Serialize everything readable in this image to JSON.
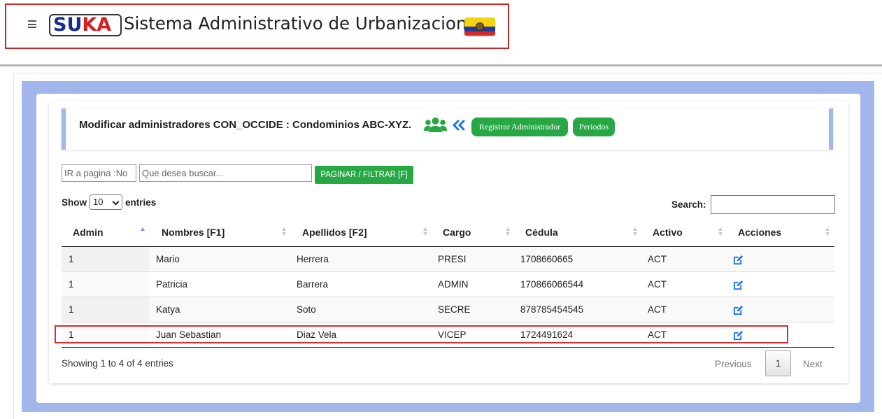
{
  "header": {
    "logo_part1": "SU",
    "logo_part2": "KA",
    "app_title": "Sistema Administrativo de Urbanizaciones"
  },
  "form": {
    "title": "Modificar administradores CON_OCCIDE : Condominios ABC-XYZ.",
    "register_button": "Registrar Administrador",
    "periods_button": "Períodos"
  },
  "filters": {
    "page_placeholder": "IR a pagina :No",
    "search_placeholder": "Que desea buscar...",
    "filter_button": "PAGINAR / FILTRAR [F]"
  },
  "table_controls": {
    "show_label": "Show",
    "page_length": "10",
    "entries_label": "entries",
    "search_label": "Search:"
  },
  "table": {
    "columns": [
      "Admin",
      "Nombres [F1]",
      "Apellidos [F2]",
      "Cargo",
      "Cédula",
      "Activo",
      "Acciones"
    ],
    "rows": [
      {
        "admin": "1",
        "nombres": "Mario",
        "apellidos": "Herrera",
        "cargo": "PRESI",
        "cedula": "1708660665",
        "activo": "ACT"
      },
      {
        "admin": "1",
        "nombres": "Patricia",
        "apellidos": "Barrera",
        "cargo": "ADMIN",
        "cedula": "170866066544",
        "activo": "ACT"
      },
      {
        "admin": "1",
        "nombres": "Katya",
        "apellidos": "Soto",
        "cargo": "SECRE",
        "cedula": "878785454545",
        "activo": "ACT"
      },
      {
        "admin": "1",
        "nombres": "Juan Sebastian",
        "apellidos": "Diaz Vela",
        "cargo": "VICEP",
        "cedula": "1724491624",
        "activo": "ACT"
      }
    ]
  },
  "pagination": {
    "info": "Showing 1 to 4 of 4 entries",
    "previous": "Previous",
    "current": "1",
    "next": "Next"
  },
  "colors": {
    "accent_green": "#28a745",
    "panel_blue": "#a3b6ec",
    "highlight_red": "#d32f2f",
    "edit_icon_blue": "#1a73e8"
  }
}
